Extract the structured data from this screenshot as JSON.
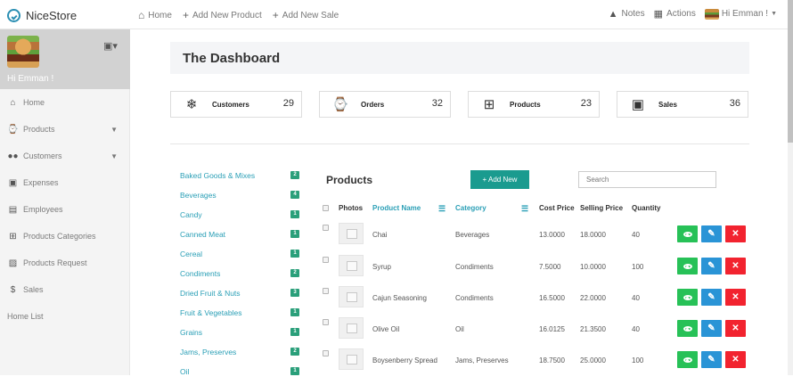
{
  "app": {
    "brand": "NiceStore"
  },
  "topnav": [
    {
      "icon": "home-icon",
      "label": "Home"
    },
    {
      "icon": "plus-icon",
      "label": "Add New Product"
    },
    {
      "icon": "plus-icon",
      "label": "Add New Sale"
    }
  ],
  "topright": {
    "notes": "Notes",
    "actions": "Actions",
    "user": "Hi Emman !"
  },
  "sidebar": {
    "greeting": "Hi Emman !",
    "items": [
      {
        "label": "Home",
        "icon": "home-icon",
        "caret": false
      },
      {
        "label": "Products",
        "icon": "cart-icon",
        "caret": true
      },
      {
        "label": "Customers",
        "icon": "users-icon",
        "caret": true
      },
      {
        "label": "Expenses",
        "icon": "wallet-icon",
        "caret": false
      },
      {
        "label": "Employees",
        "icon": "id-card-icon",
        "caret": false
      },
      {
        "label": "Products Categories",
        "icon": "category-icon",
        "caret": false
      },
      {
        "label": "Products Request",
        "icon": "truck-icon",
        "caret": false
      },
      {
        "label": "Sales",
        "icon": "dollar-icon",
        "caret": false
      },
      {
        "label": "Home List",
        "icon": "",
        "caret": false
      }
    ]
  },
  "dashboard": {
    "title": "The Dashboard",
    "stats": [
      {
        "label": "Customers",
        "value": "29",
        "icon": "snowflake-icon"
      },
      {
        "label": "Orders",
        "value": "32",
        "icon": "cart-icon"
      },
      {
        "label": "Products",
        "value": "23",
        "icon": "monitor-plus-icon"
      },
      {
        "label": "Sales",
        "value": "36",
        "icon": "wallet-icon"
      }
    ]
  },
  "categories": [
    {
      "name": "Baked Goods & Mixes",
      "count": "2"
    },
    {
      "name": "Beverages",
      "count": "4"
    },
    {
      "name": "Candy",
      "count": "1"
    },
    {
      "name": "Canned Meat",
      "count": "1"
    },
    {
      "name": "Cereal",
      "count": "1"
    },
    {
      "name": "Condiments",
      "count": "2"
    },
    {
      "name": "Dried Fruit & Nuts",
      "count": "3"
    },
    {
      "name": "Fruit & Vegetables",
      "count": "1"
    },
    {
      "name": "Grains",
      "count": "1"
    },
    {
      "name": "Jams, Preserves",
      "count": "2"
    },
    {
      "name": "Oil",
      "count": "1"
    }
  ],
  "products": {
    "title": "Products",
    "add_label": "+ Add New",
    "search_placeholder": "Search",
    "columns": {
      "photos": "Photos",
      "name": "Product Name",
      "category": "Category",
      "cost": "Cost Price",
      "selling": "Selling Price",
      "quantity": "Quantity"
    },
    "rows": [
      {
        "name": "Chai",
        "category": "Beverages",
        "cost": "13.0000",
        "selling": "18.0000",
        "quantity": "40"
      },
      {
        "name": "Syrup",
        "category": "Condiments",
        "cost": "7.5000",
        "selling": "10.0000",
        "quantity": "100"
      },
      {
        "name": "Cajun Seasoning",
        "category": "Condiments",
        "cost": "16.5000",
        "selling": "22.0000",
        "quantity": "40"
      },
      {
        "name": "Olive Oil",
        "category": "Oil",
        "cost": "16.0125",
        "selling": "21.3500",
        "quantity": "40"
      },
      {
        "name": "Boysenberry Spread",
        "category": "Jams, Preserves",
        "cost": "18.7500",
        "selling": "25.0000",
        "quantity": "100"
      }
    ]
  },
  "colors": {
    "accent": "#2a9fb6",
    "primary_button": "#1a9b8f",
    "view": "#27c157",
    "edit": "#2a94d6",
    "delete": "#f2232f"
  }
}
